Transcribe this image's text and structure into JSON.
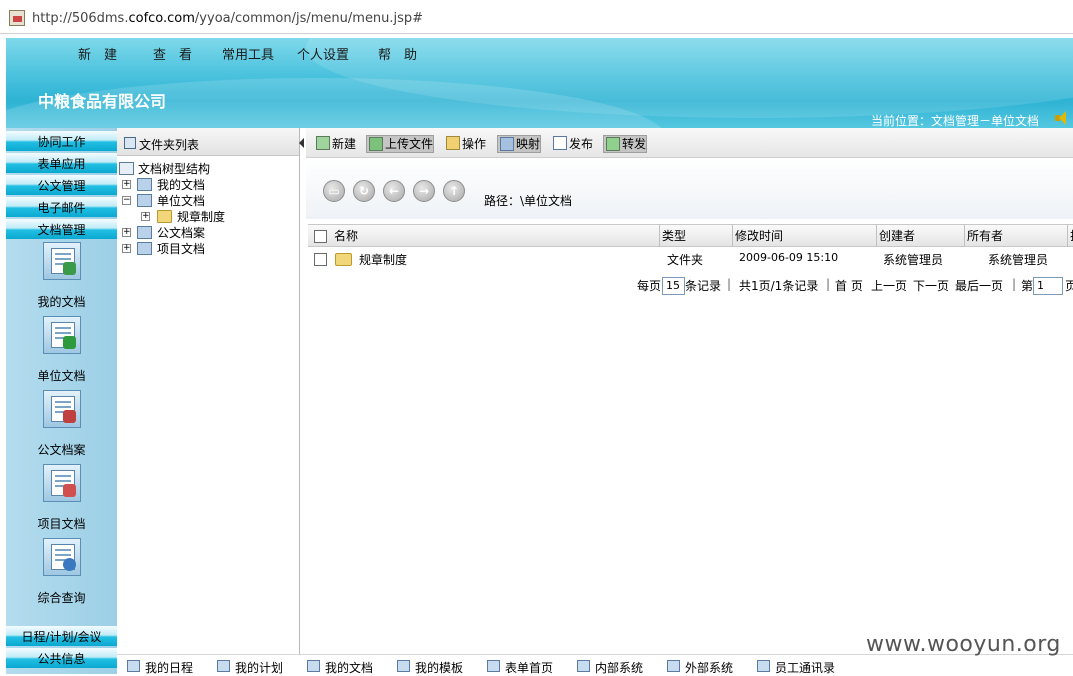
{
  "browser": {
    "url_prefix": "http://506dms.",
    "url_domain": "cofco.com",
    "url_path": "/yyoa/common/js/menu/menu.jsp#"
  },
  "top_menu": [
    "新　建",
    "查　看",
    "常用工具",
    "个人设置",
    "帮　助"
  ],
  "company": "中粮食品有限公司",
  "location": "当前位置：文档管理－单位文档",
  "left_nav": {
    "tabs_top": [
      "协同工作",
      "表单应用",
      "公文管理",
      "电子邮件",
      "文档管理"
    ],
    "icons": [
      {
        "label": "我的文档",
        "icon": "my-docs-icon",
        "badge_color": "#3a9a4a"
      },
      {
        "label": "单位文档",
        "icon": "unit-docs-icon",
        "badge_color": "#2e9a3e"
      },
      {
        "label": "公文档案",
        "icon": "archive-icon",
        "badge_color": "#c04040"
      },
      {
        "label": "项目文档",
        "icon": "project-docs-icon",
        "badge_color": "#d05050"
      },
      {
        "label": "综合查询",
        "icon": "search-icon",
        "badge_color": "#3a78c0"
      }
    ],
    "tabs_bottom": [
      "日程/计划/会议",
      "公共信息"
    ]
  },
  "folder_panel": {
    "title": "文件夹列表",
    "tree": {
      "root": "文档树型结构",
      "nodes": [
        "我的文档",
        "单位文档",
        "规章制度",
        "公文档案",
        "项目文档"
      ]
    }
  },
  "toolbar": [
    "新建",
    "上传文件",
    "操作",
    "映射",
    "发布",
    "转发"
  ],
  "path": {
    "label": "路径：",
    "value": "\\单位文档"
  },
  "grid": {
    "columns": [
      "名称",
      "类型",
      "修改时间",
      "创建者",
      "所有者",
      "排"
    ],
    "rows": [
      {
        "name": "规章制度",
        "type": "文件夹",
        "modified": "2009-06-09 15:10",
        "creator": "系统管理员",
        "owner": "系统管理员"
      }
    ]
  },
  "pager": {
    "per_page_label": "每页",
    "per_page_value": "15",
    "records_label": "条记录",
    "summary": "共1页/1条记录",
    "first": "首 页",
    "prev": "上一页",
    "next": "下一页",
    "last": "最后一页",
    "goto_label": "第",
    "goto_value": "1",
    "page_suffix": "页"
  },
  "bottom_bar": [
    "我的日程",
    "我的计划",
    "我的文档",
    "我的模板",
    "表单首页",
    "内部系统",
    "外部系统",
    "员工通讯录"
  ],
  "watermark": "www.wooyun.org"
}
